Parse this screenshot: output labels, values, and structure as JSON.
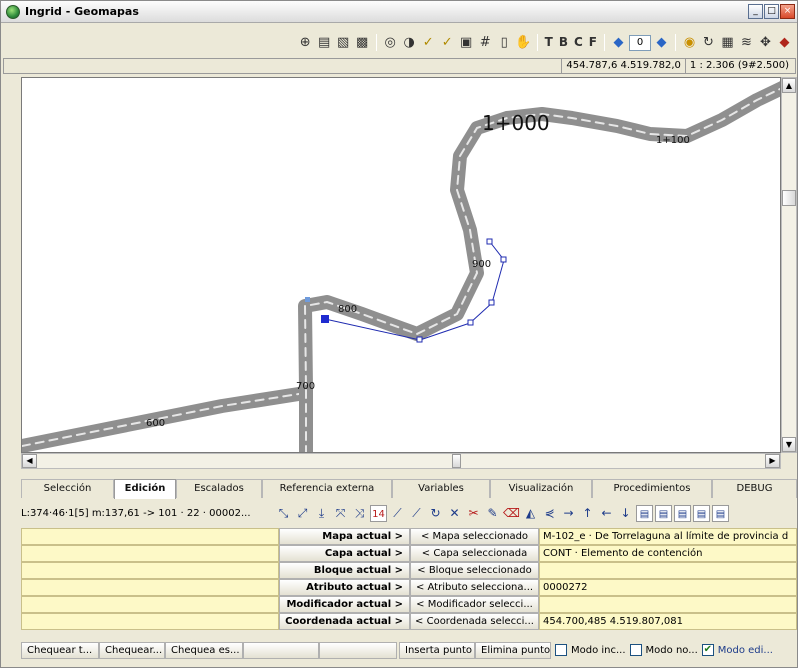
{
  "window": {
    "title": "Ingrid - Geomapas",
    "buttons": [
      "minimize",
      "maximize",
      "close"
    ]
  },
  "toolbar": {
    "page_value": "0",
    "text_menus": [
      "T",
      "B",
      "C",
      "F"
    ]
  },
  "status": {
    "coordinates": "454.787,6  4.519.782,0",
    "scale": "1 : 2.306 (9#2.500)"
  },
  "map": {
    "labels": {
      "km_1000": "1+000",
      "km_1100": "1+100",
      "m900": "900",
      "m800": "800",
      "m700": "700",
      "m600": "600"
    }
  },
  "tabs": [
    {
      "label": "Selección",
      "active": false
    },
    {
      "label": "Edición",
      "active": true
    },
    {
      "label": "Escalados",
      "active": false
    },
    {
      "label": "Referencia externa",
      "active": false
    },
    {
      "label": "Variables",
      "active": false
    },
    {
      "label": "Visualización",
      "active": false
    },
    {
      "label": "Procedimientos",
      "active": false
    },
    {
      "label": "DEBUG",
      "active": false
    }
  ],
  "edit_location": "L:374·46·1[5] m:137,61 -> 101 · 22 · 00002...",
  "rows": [
    {
      "current": "Mapa actual >",
      "selected": "< Mapa seleccionado",
      "value": "M-102_e · De Torrelaguna al límite de provincia d"
    },
    {
      "current": "Capa actual >",
      "selected": "< Capa seleccionada",
      "value": "CONT · Elemento de contención"
    },
    {
      "current": "Bloque actual >",
      "selected": "< Bloque seleccionado",
      "value": ""
    },
    {
      "current": "Atributo actual >",
      "selected": "< Atributo selecciona...",
      "value": "0000272"
    },
    {
      "current": "Modificador actual >",
      "selected": "< Modificador selecci...",
      "value": ""
    },
    {
      "current": "Coordenada actual >",
      "selected": "< Coordenada selecci...",
      "value": "454.700,485  4.519.807,081"
    }
  ],
  "bottom": {
    "buttons": [
      "Chequear t...",
      "Chequear...",
      "Chequea es..."
    ],
    "insert_point": "Inserta punto",
    "delete_point": "Elimina punto",
    "checks": [
      {
        "label": "Modo inc...",
        "checked": false
      },
      {
        "label": "Modo no...",
        "checked": false
      },
      {
        "label": "Modo edi...",
        "checked": true
      }
    ]
  }
}
